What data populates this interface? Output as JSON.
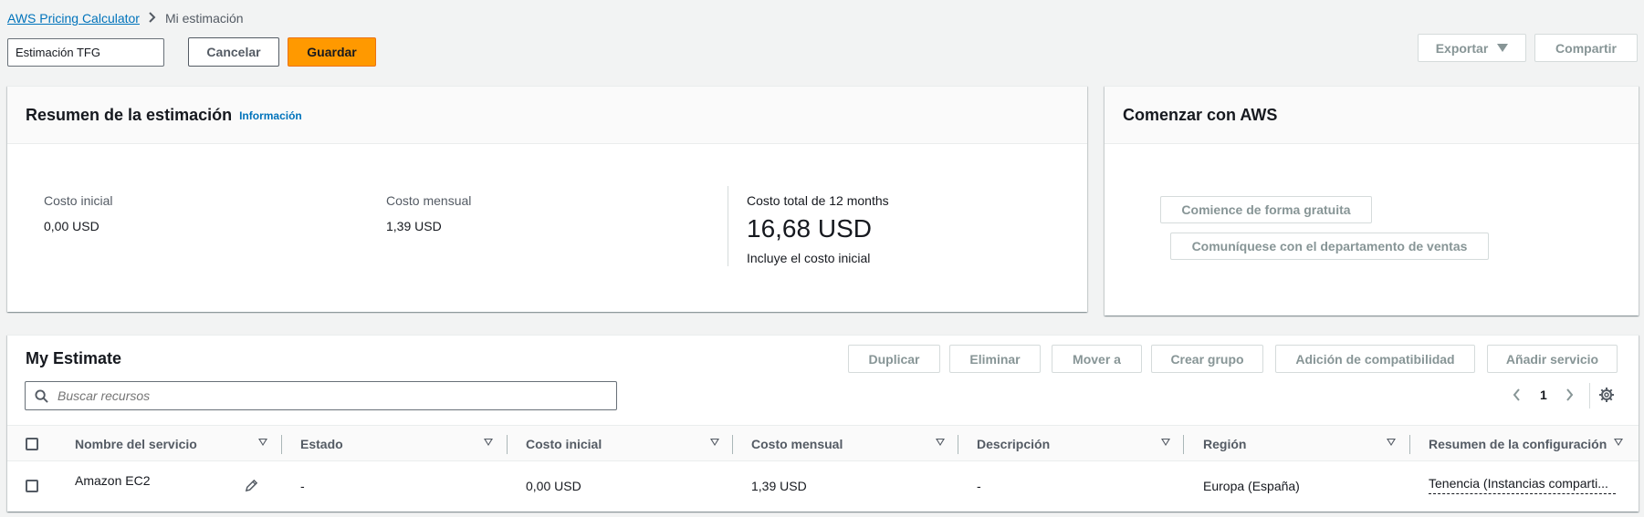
{
  "breadcrumb": {
    "root": "AWS Pricing Calculator",
    "current": "Mi estimación"
  },
  "estimate_name": "Estimación TFG",
  "actions": {
    "cancel": "Cancelar",
    "save": "Guardar",
    "export": "Exportar",
    "share": "Compartir"
  },
  "summary": {
    "title": "Resumen de la estimación",
    "info": "Información",
    "upfront_label": "Costo inicial",
    "upfront_value": "0,00 USD",
    "monthly_label": "Costo mensual",
    "monthly_value": "1,39 USD",
    "total_label": "Costo total de 12 months",
    "total_value": "16,68 USD",
    "total_note": "Incluye el costo inicial"
  },
  "getting_started": {
    "title": "Comenzar con AWS",
    "free_button": "Comience de forma gratuita",
    "sales_button": "Comuníquese con el departamento de ventas"
  },
  "estimate": {
    "title": "My Estimate",
    "buttons": [
      "Duplicar",
      "Eliminar",
      "Mover a",
      "Crear grupo",
      "Adición de compatibilidad",
      "Añadir servicio"
    ],
    "search_placeholder": "Buscar recursos",
    "page": "1",
    "columns": [
      "Nombre del servicio",
      "Estado",
      "Costo inicial",
      "Costo mensual",
      "Descripción",
      "Región",
      "Resumen de la configuración"
    ],
    "rows": [
      {
        "service": "Amazon EC2",
        "status": "-",
        "upfront": "0,00 USD",
        "monthly": "1,39 USD",
        "description": "-",
        "region": "Europa (España)",
        "config": "Tenencia (Instancias comparti..."
      }
    ]
  },
  "icons": {
    "breadcrumb_separator": "chevron-right-icon",
    "export_caret": "caret-down-icon",
    "search": "search-icon",
    "prev": "chevron-left-icon",
    "next": "chevron-right-icon",
    "settings": "gear-icon",
    "edit": "pencil-icon",
    "sort": "caret-down-icon"
  },
  "colors": {
    "primary": "#ff9900",
    "link": "#0073bb",
    "text": "#16191f",
    "muted": "#545b64",
    "disabled": "#879596"
  }
}
